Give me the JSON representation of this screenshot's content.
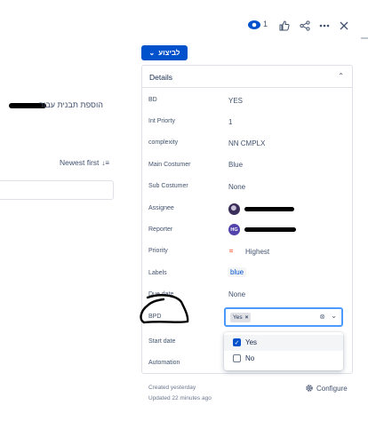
{
  "toolbar": {
    "watch_count": "1",
    "icons": [
      "eye-icon",
      "thumbs-up-icon",
      "share-icon",
      "more-icon",
      "close-icon"
    ]
  },
  "left_pane": {
    "hebrew_text": "הוספת תבנית עבור",
    "sort_label": "Newest first",
    "sort_icon": "↓≡"
  },
  "status_button": {
    "label": "לביצוע",
    "chevron": "⌄"
  },
  "details": {
    "title": "Details",
    "fields": [
      {
        "label": "BD",
        "value": "YES"
      },
      {
        "label": "Int Priorty",
        "value": "1"
      },
      {
        "label": "complexity",
        "value": "NN CMPLX"
      },
      {
        "label": "Main Costumer",
        "value": "Blue"
      },
      {
        "label": "Sub Costumer",
        "value": "None"
      },
      {
        "label": "Assignee",
        "value": ""
      },
      {
        "label": "Reporter",
        "value": "",
        "avatar_initials": "HG"
      },
      {
        "label": "Priority",
        "value": "Highest"
      },
      {
        "label": "Labels",
        "value": "blue"
      },
      {
        "label": "Due date",
        "value": "None"
      },
      {
        "label": "BPD",
        "value": ""
      },
      {
        "label": "Start date",
        "value": ""
      },
      {
        "label": "Automation",
        "value": ""
      }
    ]
  },
  "bpd_select": {
    "chip": "Yes",
    "options": [
      {
        "label": "Yes",
        "checked": true
      },
      {
        "label": "No",
        "checked": false
      }
    ]
  },
  "footer": {
    "created": "Created yesterday",
    "updated": "Updated 22 minutes ago",
    "configure": "Configure"
  },
  "colors": {
    "accent": "#0052cc",
    "focus": "#4c9aff",
    "priority": "#ff5630"
  }
}
